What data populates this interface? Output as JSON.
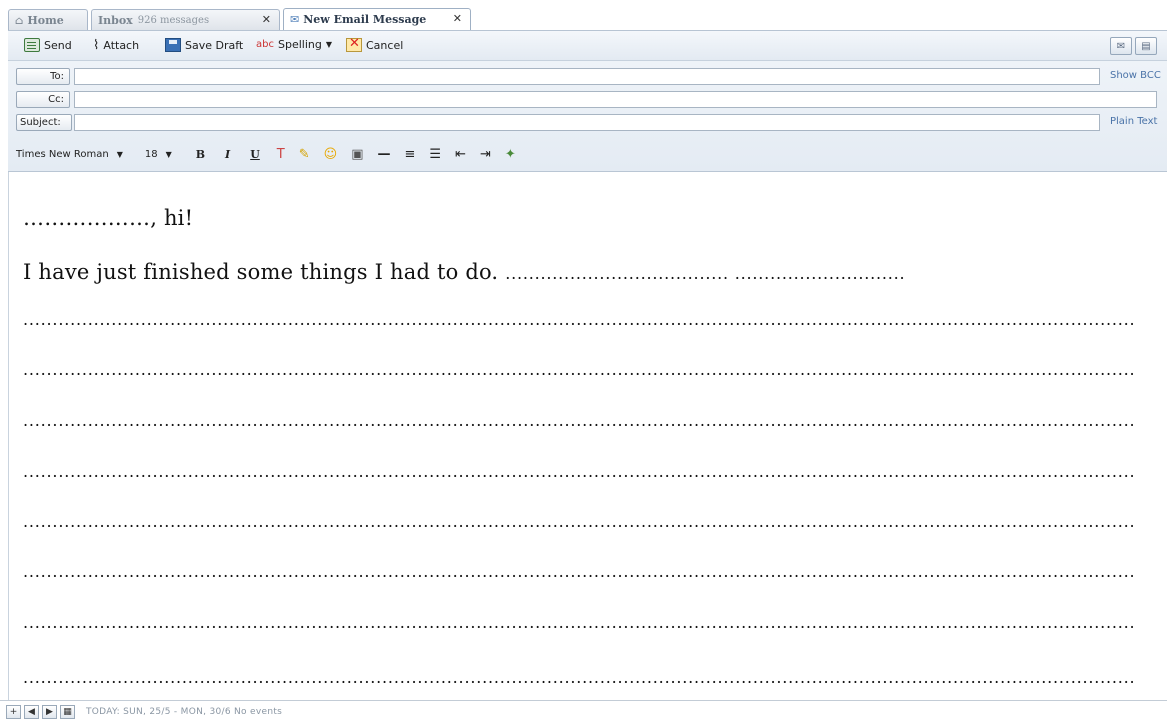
{
  "tabs": [
    {
      "label": "Home",
      "sub": "",
      "closable": false
    },
    {
      "label": "Inbox",
      "sub": "926 messages",
      "closable": true
    },
    {
      "label": "New Email Message",
      "sub": "",
      "closable": true,
      "active": true
    }
  ],
  "toolbar": {
    "send": "Send",
    "attach": "Attach",
    "save_draft": "Save Draft",
    "spelling": "Spelling",
    "cancel": "Cancel"
  },
  "header": {
    "to_label": "To:",
    "cc_label": "Cc:",
    "subject_label": "Subject:",
    "to_value": "",
    "cc_value": "",
    "subject_value": "",
    "show_bcc": "Show BCC",
    "plain_text": "Plain Text"
  },
  "format": {
    "font": "Times New Roman",
    "size": "18"
  },
  "body": {
    "greeting": "………………, hi!",
    "sentence": "I have just finished some things I had to do.",
    "dots_tail": "......................................  .............................",
    "dot_line": "................................................................................................................................................................................................................................................"
  },
  "status": {
    "text": "TODAY: SUN, 25/5 - MON, 30/6  No events"
  },
  "colors": {
    "accent": "#4a73a8",
    "toolbar_bg": "#e3eaf2"
  }
}
